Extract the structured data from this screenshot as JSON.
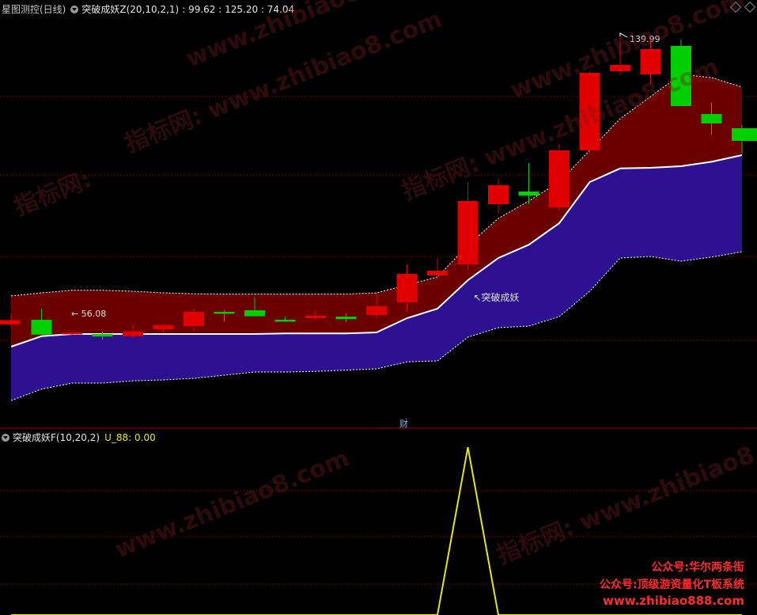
{
  "top_header": {
    "app_title": "星图测控(日线)",
    "indicator_name": "突破成妖Z(20,10,2,1)",
    "values": ": 99.62 : 125.20 : 74.04"
  },
  "bottom_header": {
    "indicator_name": "突破成妖F(10,20,2)",
    "value_label": "U_88: 0.00"
  },
  "divider_label": "财",
  "annotations": {
    "high_label": "139.99",
    "low_label": "56.08",
    "signal_label": "突破成妖"
  },
  "promo": {
    "line1": "公众号:华尔两条街",
    "line2": "公众号:顶级游资量化T板系统",
    "line3": "www.zhibiao888.com"
  },
  "watermarks": [
    "指标网: www.zhibiao8.com",
    "www.zhibiao8.com",
    "指标网: www.zhibiao8.com",
    "www.zhibiao8.com",
    "www.zhibiao8.com",
    "指标网: www.zhibiao8.com",
    "指标网:"
  ],
  "colors": {
    "background": "#000000",
    "up_candle": "#e00000",
    "down_candle": "#00d000",
    "upper_band": "#6b0000",
    "lower_band": "#2e1190",
    "signal_line": "#e8e800"
  },
  "chart_data": {
    "type": "candlestick",
    "candles": [
      {
        "open": 71.0,
        "high": 74.5,
        "low": 70.2,
        "close": 72.4
      },
      {
        "open": 72.5,
        "high": 76.0,
        "low": 68.0,
        "close": 67.8
      },
      {
        "open": 68.3,
        "high": 69.0,
        "low": 67.5,
        "close": 68.4
      },
      {
        "open": 68.0,
        "high": 68.8,
        "low": 66.2,
        "close": 67.2
      },
      {
        "open": 67.3,
        "high": 71.0,
        "low": 66.5,
        "close": 68.8
      },
      {
        "open": 69.5,
        "high": 71.0,
        "low": 68.5,
        "close": 70.8
      },
      {
        "open": 70.5,
        "high": 76.0,
        "low": 68.8,
        "close": 75.0
      },
      {
        "open": 75.0,
        "high": 75.6,
        "low": 72.0,
        "close": 74.4
      },
      {
        "open": 75.5,
        "high": 79.5,
        "low": 73.8,
        "close": 73.6
      },
      {
        "open": 72.5,
        "high": 73.5,
        "low": 71.8,
        "close": 71.9
      },
      {
        "open": 73.0,
        "high": 75.3,
        "low": 72.5,
        "close": 73.8
      },
      {
        "open": 73.5,
        "high": 74.5,
        "low": 71.8,
        "close": 72.7
      },
      {
        "open": 74.0,
        "high": 81.0,
        "low": 73.0,
        "close": 76.8
      },
      {
        "open": 78.0,
        "high": 90.0,
        "low": 75.0,
        "close": 87.0
      },
      {
        "open": 86.5,
        "high": 92.0,
        "low": 85.0,
        "close": 88.0
      },
      {
        "open": 90.0,
        "high": 116.0,
        "low": 88.0,
        "close": 110.0
      },
      {
        "open": 109.0,
        "high": 117.0,
        "low": 106.0,
        "close": 115.0
      },
      {
        "open": 113.0,
        "high": 122.0,
        "low": 109.0,
        "close": 111.7
      },
      {
        "open": 108.0,
        "high": 128.0,
        "low": 107.0,
        "close": 126.0
      },
      {
        "open": 126.0,
        "high": 151.0,
        "low": 124.5,
        "close": 150.5
      },
      {
        "open": 151.0,
        "high": 162.0,
        "low": 150.0,
        "close": 153.0
      },
      {
        "open": 150.0,
        "high": 162.0,
        "low": 147.0,
        "close": 158.0
      },
      {
        "open": 159.0,
        "high": 161.0,
        "low": 140.0,
        "close": 140.0
      },
      {
        "open": 137.5,
        "high": 141.0,
        "low": 131.0,
        "close": 134.5
      },
      {
        "open": 133.0,
        "high": 134.0,
        "low": 125.0,
        "close": 129.0
      }
    ],
    "upper_band": [
      80.0,
      81.0,
      81.8,
      81.8,
      81.5,
      81.0,
      80.7,
      80.6,
      80.6,
      80.6,
      80.6,
      80.6,
      81.0,
      83.5,
      86.0,
      96.0,
      104.5,
      110.0,
      116.0,
      126.0,
      136.0,
      143.0,
      150.0,
      149.0,
      146.0
    ],
    "mid_line": [
      64.0,
      67.3,
      68.0,
      68.0,
      68.0,
      68.0,
      68.0,
      68.0,
      68.0,
      68.2,
      68.2,
      68.2,
      68.5,
      73.0,
      76.0,
      85.0,
      92.0,
      96.2,
      103.0,
      116.0,
      120.3,
      120.5,
      121.0,
      122.4,
      124.5
    ],
    "lower_band": [
      47.0,
      50.6,
      52.5,
      52.5,
      53.2,
      53.5,
      54.0,
      55.0,
      56.0,
      56.0,
      56.2,
      56.6,
      57.0,
      59.2,
      59.5,
      67.0,
      70.0,
      70.5,
      73.5,
      81.5,
      92.0,
      92.5,
      91.0,
      92.3,
      94.0
    ],
    "highest_price": 139.99,
    "lowest_price": 56.08,
    "signal_values": [
      0,
      0,
      0,
      0,
      0,
      0,
      0,
      0,
      0,
      0,
      0,
      0,
      0,
      0,
      0,
      1,
      0,
      0,
      0,
      0,
      0,
      0,
      0,
      0,
      0
    ]
  }
}
